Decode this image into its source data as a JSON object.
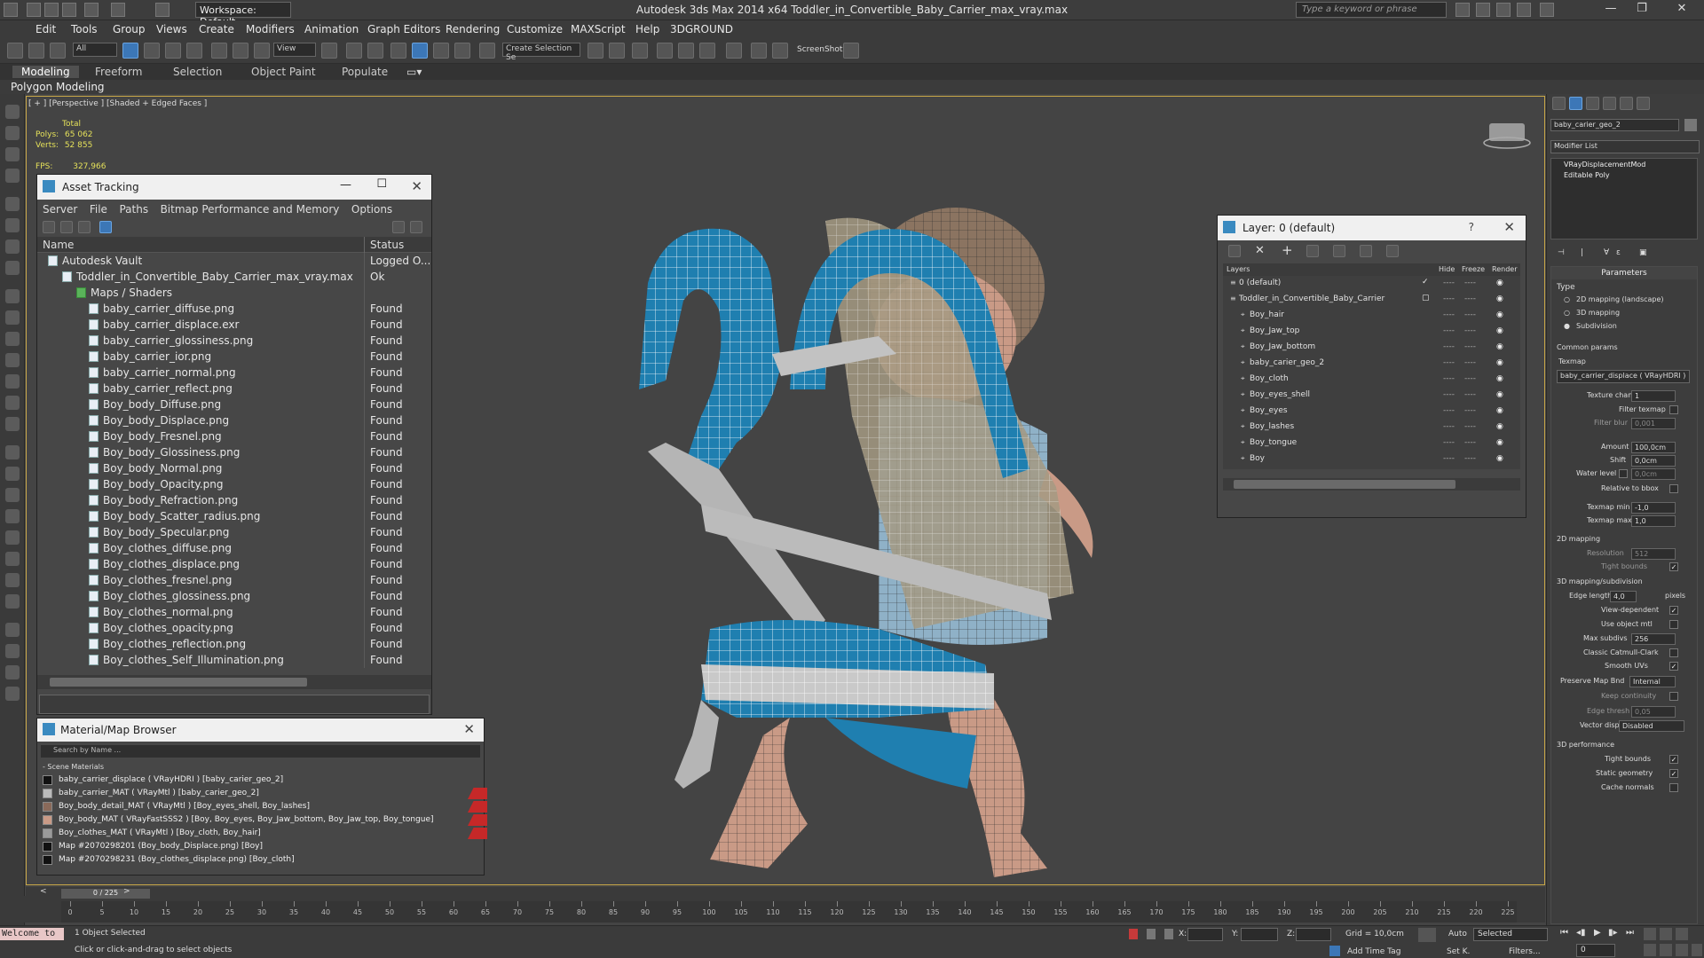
{
  "app": {
    "title": "Autodesk 3ds Max  2014 x64      Toddler_in_Convertible_Baby_Carrier_max_vray.max",
    "workspace": "Workspace: Default",
    "search_placeholder": "Type a keyword or phrase"
  },
  "menu": [
    "Edit",
    "Tools",
    "Group",
    "Views",
    "Create",
    "Modifiers",
    "Animation",
    "Graph Editors",
    "Rendering",
    "Customize",
    "MAXScript",
    "Help",
    "3DGROUND"
  ],
  "toolbar": {
    "selection_filter": "All",
    "coord_system": "View",
    "named_selection": "Create Selection Se",
    "screenshot_label": "ScreenShot"
  },
  "ribbon": {
    "tabs": [
      "Modeling",
      "Freeform",
      "Selection",
      "Object Paint",
      "Populate"
    ],
    "active_tab": "Modeling",
    "sub_label": "Polygon Modeling"
  },
  "viewport": {
    "label": "[ + ] [Perspective ] [Shaded + Edged Faces ]",
    "stats": {
      "total_label": "Total",
      "polys_label": "Polys:",
      "polys": "65 062",
      "verts_label": "Verts:",
      "verts": "52 855",
      "fps_label": "FPS:",
      "fps": "327,966"
    }
  },
  "asset_tracking": {
    "title": "Asset Tracking",
    "menu": [
      "Server",
      "File",
      "Paths",
      "Bitmap Performance and Memory",
      "Options"
    ],
    "columns": [
      "Name",
      "Status"
    ],
    "rows": [
      {
        "name": "Autodesk Vault",
        "status": "Logged O..."
      },
      {
        "name": "Toddler_in_Convertible_Baby_Carrier_max_vray.max",
        "status": "Ok"
      },
      {
        "name": "Maps / Shaders",
        "status": ""
      },
      {
        "name": "baby_carrier_diffuse.png",
        "status": "Found"
      },
      {
        "name": "baby_carrier_displace.exr",
        "status": "Found"
      },
      {
        "name": "baby_carrier_glossiness.png",
        "status": "Found"
      },
      {
        "name": "baby_carrier_ior.png",
        "status": "Found"
      },
      {
        "name": "baby_carrier_normal.png",
        "status": "Found"
      },
      {
        "name": "baby_carrier_reflect.png",
        "status": "Found"
      },
      {
        "name": "Boy_body_Diffuse.png",
        "status": "Found"
      },
      {
        "name": "Boy_body_Displace.png",
        "status": "Found"
      },
      {
        "name": "Boy_body_Fresnel.png",
        "status": "Found"
      },
      {
        "name": "Boy_body_Glossiness.png",
        "status": "Found"
      },
      {
        "name": "Boy_body_Normal.png",
        "status": "Found"
      },
      {
        "name": "Boy_body_Opacity.png",
        "status": "Found"
      },
      {
        "name": "Boy_body_Refraction.png",
        "status": "Found"
      },
      {
        "name": "Boy_body_Scatter_radius.png",
        "status": "Found"
      },
      {
        "name": "Boy_body_Specular.png",
        "status": "Found"
      },
      {
        "name": "Boy_clothes_diffuse.png",
        "status": "Found"
      },
      {
        "name": "Boy_clothes_displace.png",
        "status": "Found"
      },
      {
        "name": "Boy_clothes_fresnel.png",
        "status": "Found"
      },
      {
        "name": "Boy_clothes_glossiness.png",
        "status": "Found"
      },
      {
        "name": "Boy_clothes_normal.png",
        "status": "Found"
      },
      {
        "name": "Boy_clothes_opacity.png",
        "status": "Found"
      },
      {
        "name": "Boy_clothes_reflection.png",
        "status": "Found"
      },
      {
        "name": "Boy_clothes_Self_Illumination.png",
        "status": "Found"
      }
    ]
  },
  "material_browser": {
    "title": "Material/Map Browser",
    "search_placeholder": "Search by Name ...",
    "section": "- Scene Materials",
    "items": [
      "baby_carrier_displace  ( VRayHDRI ) [baby_carier_geo_2]",
      "baby_carrier_MAT  ( VRayMtl ) [baby_carier_geo_2]",
      "Boy_body_detail_MAT  ( VRayMtl ) [Boy_eyes_shell, Boy_lashes]",
      "Boy_body_MAT  ( VRayFastSSS2 ) [Boy, Boy_eyes, Boy_Jaw_bottom, Boy_Jaw_top, Boy_tongue]",
      "Boy_clothes_MAT  ( VRayMtl ) [Boy_cloth, Boy_hair]",
      "Map #2070298201 (Boy_body_Displace.png) [Boy]",
      "Map #2070298231 (Boy_clothes_displace.png) [Boy_cloth]"
    ]
  },
  "layer_manager": {
    "title": "Layer: 0 (default)",
    "columns": [
      "Layers",
      "Hide",
      "Freeze",
      "Render"
    ],
    "layers": [
      "0 (default)",
      "Toddler_in_Convertible_Baby_Carrier",
      "Boy_hair",
      "Boy_Jaw_top",
      "Boy_Jaw_bottom",
      "baby_carier_geo_2",
      "Boy_cloth",
      "Boy_eyes_shell",
      "Boy_eyes",
      "Boy_lashes",
      "Boy_tongue",
      "Boy"
    ]
  },
  "command_panel": {
    "object_name": "baby_carier_geo_2",
    "modifier_list": "Modifier List",
    "stack": [
      "VRayDisplacementMod",
      "Editable Poly"
    ],
    "parameters_title": "Parameters",
    "type_label": "Type",
    "type_options": [
      "2D mapping (landscape)",
      "3D mapping",
      "Subdivision"
    ],
    "common_params": "Common params",
    "texmap_label": "Texmap",
    "texmap_value": "baby_carrier_displace  ( VRayHDRI )",
    "texture_chan_label": "Texture chan",
    "texture_chan": "1",
    "filter_texmap_label": "Filter texmap",
    "filter_blur_label": "Filter blur",
    "filter_blur": "0,001",
    "amount_label": "Amount",
    "amount": "100,0cm",
    "shift_label": "Shift",
    "shift": "0,0cm",
    "water_level_label": "Water level",
    "water_level": "0,0cm",
    "relative_bbox_label": "Relative to bbox",
    "texmap_min_label": "Texmap min",
    "texmap_min": "-1,0",
    "texmap_max_label": "Texmap max",
    "texmap_max": "1,0",
    "mapping2d_title": "2D mapping",
    "resolution_label": "Resolution",
    "resolution": "512",
    "tight_bounds_label": "Tight bounds",
    "sub_title": "3D mapping/subdivision",
    "edge_length_label": "Edge length",
    "edge_length": "4,0",
    "pixels_label": "pixels",
    "view_dependent_label": "View-dependent",
    "use_object_mtl_label": "Use object mtl",
    "max_subdivs_label": "Max subdivs",
    "max_subdivs": "256",
    "catmull_label": "Classic Catmull-Clark",
    "smooth_uvs_label": "Smooth UVs",
    "preserve_map_label": "Preserve Map Bnd",
    "preserve_map": "Internal",
    "keep_continuity_label": "Keep continuity",
    "edge_thresh_label": "Edge thresh",
    "edge_thresh": "0,05",
    "vector_displ_label": "Vector displ",
    "vector_displ": "Disabled",
    "perf_title": "3D performance",
    "perf_tight_bounds_label": "Tight bounds",
    "static_geometry_label": "Static geometry",
    "cache_normals_label": "Cache normals"
  },
  "timeline": {
    "frame_label": "0 / 225",
    "ticks": [
      "0",
      "5",
      "10",
      "15",
      "20",
      "25",
      "30",
      "35",
      "40",
      "45",
      "50",
      "55",
      "60",
      "65",
      "70",
      "75",
      "80",
      "85",
      "90",
      "95",
      "100",
      "105",
      "110",
      "115",
      "120",
      "125",
      "130",
      "135",
      "140",
      "145",
      "150",
      "155",
      "160",
      "165",
      "170",
      "175",
      "180",
      "185",
      "190",
      "195",
      "200",
      "205",
      "210",
      "215",
      "220",
      "225"
    ]
  },
  "status": {
    "welcome": "Welcome to",
    "selection": "1 Object Selected",
    "prompt": "Click or click-and-drag to select objects",
    "x_label": "X:",
    "y_label": "Y:",
    "z_label": "Z:",
    "grid": "Grid = 10,0cm",
    "add_time_tag": "Add Time Tag",
    "auto": "Auto",
    "set_k": "Set K.",
    "selected": "Selected",
    "filters": "Filters...",
    "frame": "0"
  },
  "colors": {
    "accent": "#3c77b7",
    "viewport_border": "#c9a848",
    "stats_text": "#e4e05a",
    "strap_blue": "#1f7fb0",
    "skin": "#c99a86"
  }
}
